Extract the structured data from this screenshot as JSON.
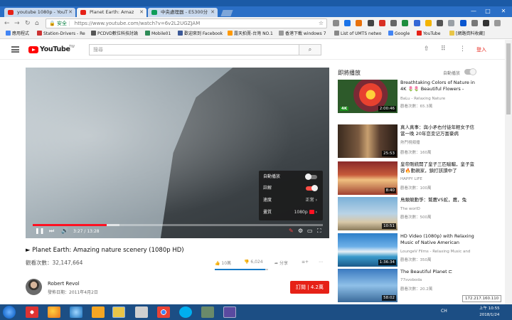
{
  "browser": {
    "tabs": [
      {
        "label": "youtube 1080p - YouT",
        "active": false,
        "icon_color": "#e62117"
      },
      {
        "label": "Planet Earth: Amaz",
        "active": true,
        "icon_color": "#e62117"
      },
      {
        "label": "中央處理器 - E5300分",
        "active": false,
        "icon_color": "#0f9d58"
      }
    ],
    "window_controls": [
      "—",
      "□",
      "✕"
    ],
    "secure_label": "安全",
    "url": "https://www.youtube.com/watch?v=6v2L2UGZJAM",
    "bookmarks": [
      "應用程式",
      "Station-Drivers - Re",
      "PCDVD數位科技討論",
      "Mobile01",
      "歡迎來到 Facebook",
      "露天拍賣-台灣 NO.1",
      "香港下載 windows 7",
      "List of UMTS netwo",
      "Google",
      "YouTube",
      "[網路資料收藏]"
    ]
  },
  "youtube": {
    "logo_text": "YouTube",
    "region": "TW",
    "search_placeholder": "搜尋",
    "signin_label": "登入"
  },
  "player": {
    "settings_menu": {
      "autoplay_label": "自動播放",
      "annotations_label": "註解",
      "speed_label": "速度",
      "speed_value": "正常",
      "quality_label": "畫質",
      "quality_value": "1080p"
    },
    "current_time": "3:27",
    "duration": "13:28",
    "progress_fraction": 0.256,
    "buffered_fraction": 0.3
  },
  "video": {
    "title": "Planet Earth: Amazing nature scenery (1080p HD)",
    "views": "觀看次數：32,147,664",
    "likes": "10萬",
    "dislikes": "6,024",
    "like_fraction": 0.94,
    "share_label": "分享",
    "add_label": "",
    "more_label": "⋯",
    "channel": "Robert Revol",
    "published": "發佈日期：2011年4月2日",
    "subscribe_label": "訂閱 | 4.2萬"
  },
  "sidebar": {
    "up_next_label": "即將播放",
    "autoplay_label": "自動播放",
    "recommendations": [
      {
        "title": "Breathtaking Colors of Nature in 4K 🌷🌷 Beautiful Flowers -",
        "channel": "BaLu - Relaxing Nature",
        "views": "觀看次數：65.3萬",
        "duration": "2:00:46"
      },
      {
        "title": "真人真事：與小矛右付徒年輕女子信當一晚 20年恋变记万富豪病",
        "channel": "熱門視頻播",
        "views": "觀看次數：160萬",
        "duration": "25:53"
      },
      {
        "title": "皇帝剛統開了皇子三匹駿騮，皇子蛮容🔥動親家，鎮打該讀中了",
        "channel": "HAPPY LIFE",
        "views": "觀看次數：100萬",
        "duration": "8:40"
      },
      {
        "title": "鳥類競動爭：鷲鷹VS蛇，鷹，兔",
        "channel": "The worlD",
        "views": "觀看次數：500萬",
        "duration": "10:51"
      },
      {
        "title": "HD Video (1080p) with Relaxing Music of Native American",
        "channel": "LoungeV Films - Relaxing Music and",
        "views": "觀看次數：350萬",
        "duration": "1:36:34"
      },
      {
        "title": "The Beautiful Planet ⊏",
        "channel": "77svoboda",
        "views": "觀看次數：20.2萬",
        "duration": "58:02"
      }
    ]
  },
  "ip_address": "172.217.160.110",
  "taskbar": {
    "tray_text": "CH",
    "time": "上午 10:55",
    "date": "2018/1/24"
  }
}
